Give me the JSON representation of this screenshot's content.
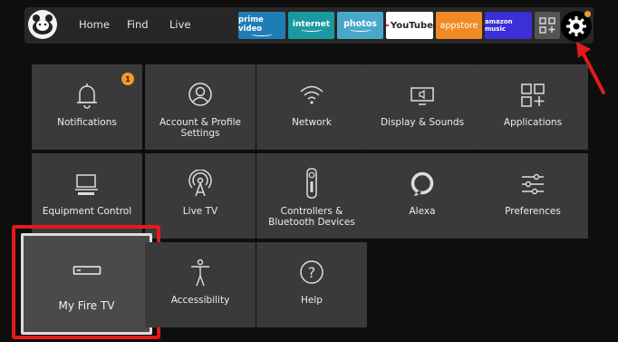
{
  "nav": {
    "home": "Home",
    "find": "Find",
    "live": "Live"
  },
  "apps": [
    {
      "label": "prime video",
      "bg": "#1f7db6"
    },
    {
      "label": "internet",
      "bg": "#1a9aa0"
    },
    {
      "label": "photos",
      "bg": "#49a8c9"
    },
    {
      "label": "YouTube",
      "bg": "#ffffff"
    },
    {
      "label": "appstore",
      "bg": "#f08a24"
    },
    {
      "label": "amazon music",
      "bg": "#3b2fd6"
    }
  ],
  "tiles": [
    {
      "label": "Notifications",
      "badge": "1"
    },
    {
      "label": "Account & Profile Settings"
    },
    {
      "label": "Network"
    },
    {
      "label": "Display & Sounds"
    },
    {
      "label": "Applications"
    },
    {
      "label": "Equipment Control"
    },
    {
      "label": "Live TV"
    },
    {
      "label": "Controllers & Bluetooth Devices"
    },
    {
      "label": "Alexa"
    },
    {
      "label": "Preferences"
    },
    {
      "label": "My Fire TV"
    },
    {
      "label": "Accessibility"
    },
    {
      "label": "Help"
    }
  ],
  "colors": {
    "accent": "#f29a2c",
    "highlight": "#e11b1b",
    "tile": "#3a3a3a"
  }
}
